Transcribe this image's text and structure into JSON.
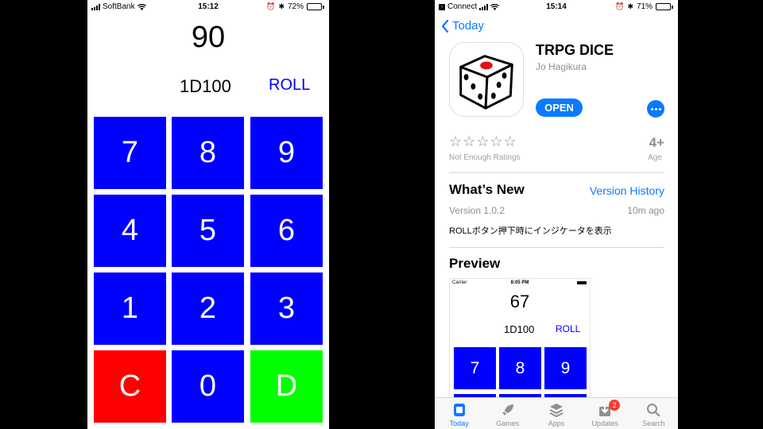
{
  "left_phone": {
    "status": {
      "carrier": "SoftBank",
      "time": "15:12",
      "battery": "72%",
      "battery_level": 0.72
    },
    "result": "90",
    "dice_expression": "1D100",
    "roll_label": "ROLL",
    "keys": [
      "7",
      "8",
      "9",
      "4",
      "5",
      "6",
      "1",
      "2",
      "3",
      "C",
      "0",
      "D"
    ],
    "colors": {
      "number_key": "#0000ff",
      "clear_key": "#ff0000",
      "dice_key": "#00ff00",
      "roll_text": "#0000ff"
    }
  },
  "right_phone": {
    "status": {
      "carrier": "Connect",
      "time": "15:14",
      "battery": "71%",
      "battery_level": 0.71
    },
    "back_label": "Today",
    "app": {
      "title": "TRPG DICE",
      "developer": "Jo Hagikura",
      "open_label": "OPEN"
    },
    "ratings": {
      "stars": "☆☆☆☆☆",
      "note": "Not Enough Ratings",
      "age": "4+",
      "age_label": "Age"
    },
    "whats_new": {
      "title": "What’s New",
      "history_label": "Version History",
      "version": "Version 1.0.2",
      "ago": "10m ago",
      "notes": "ROLLボタン押下時にインジケータを表示"
    },
    "preview": {
      "title": "Preview",
      "carrier": "Carrier",
      "time": "8:05 PM",
      "result": "67",
      "dice_expression": "1D100",
      "roll_label": "ROLL",
      "keys": [
        "7",
        "8",
        "9"
      ]
    },
    "tabs": [
      {
        "label": "Today",
        "icon": "today-icon",
        "active": true
      },
      {
        "label": "Games",
        "icon": "rocket-icon"
      },
      {
        "label": "Apps",
        "icon": "stack-icon"
      },
      {
        "label": "Updates",
        "icon": "download-icon",
        "badge": "2"
      },
      {
        "label": "Search",
        "icon": "search-icon"
      }
    ],
    "accent": "#0a7aff"
  }
}
